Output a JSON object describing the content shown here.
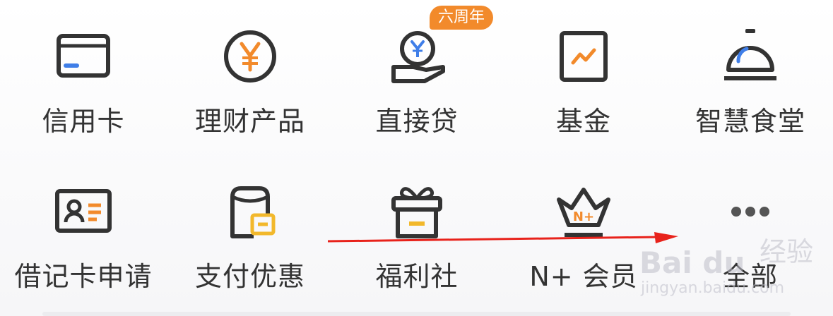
{
  "menu": {
    "row1": [
      {
        "label": "信用卡",
        "icon": "credit-card-icon"
      },
      {
        "label": "理财产品",
        "icon": "yen-coin-icon"
      },
      {
        "label": "直接贷",
        "icon": "hand-coin-icon",
        "badge": "六周年"
      },
      {
        "label": "基金",
        "icon": "fund-chart-icon"
      },
      {
        "label": "智慧食堂",
        "icon": "dining-cloche-icon"
      }
    ],
    "row2": [
      {
        "label": "借记卡申请",
        "icon": "id-card-icon"
      },
      {
        "label": "支付优惠",
        "icon": "envelope-discount-icon"
      },
      {
        "label": "福利社",
        "icon": "gift-icon"
      },
      {
        "label": "N+ 会员",
        "icon": "crown-icon"
      },
      {
        "label": "全部",
        "icon": "more-dots-icon"
      }
    ]
  },
  "watermark": {
    "logo": "Bai du",
    "cn": "经验",
    "url": "jingyan.baidu.com"
  },
  "colors": {
    "accent_orange": "#f28a2b",
    "accent_blue": "#3f7ee8",
    "accent_yellow": "#f2b82b",
    "outline": "#333333",
    "arrow": "#e8221b"
  }
}
